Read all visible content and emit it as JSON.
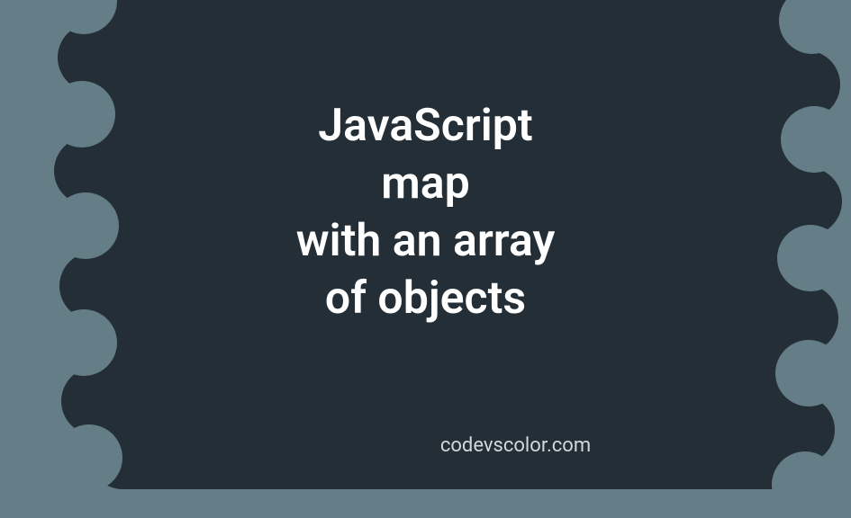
{
  "title": {
    "line1": "JavaScript",
    "line2": "map",
    "line3": "with an array",
    "line4": "of objects"
  },
  "watermark": "codevscolor.com",
  "colors": {
    "background": "#647d87",
    "blob": "#242e36",
    "text": "#ffffff",
    "watermark": "#d3d8da"
  }
}
